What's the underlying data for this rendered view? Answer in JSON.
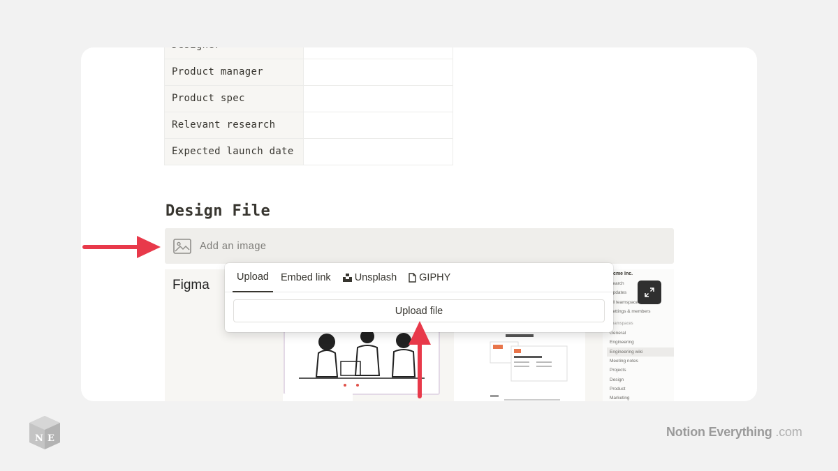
{
  "properties": [
    {
      "label": "Designer"
    },
    {
      "label": "Product manager"
    },
    {
      "label": "Product spec"
    },
    {
      "label": "Relevant research"
    },
    {
      "label": "Expected launch date"
    }
  ],
  "section_heading": "Design File",
  "add_image_label": "Add an image",
  "embed": {
    "title": "Figma",
    "sidebar": {
      "workspace": "Acme Inc.",
      "top_items": [
        "Search",
        "Updates",
        "All teamspaces",
        "Settings & members"
      ],
      "section_label": "Teamspaces",
      "items": [
        "General",
        "Engineering",
        "Engineering wiki",
        "Meeting notes",
        "Projects",
        "Design",
        "Product",
        "Marketing"
      ]
    }
  },
  "popover": {
    "tabs": [
      "Upload",
      "Embed link",
      "Unsplash",
      "GIPHY"
    ],
    "active_tab": "Upload",
    "upload_button": "Upload file"
  },
  "footer": {
    "logo_letters": "NE",
    "brand_name": "Notion Everything",
    "brand_suffix": ".com"
  },
  "colors": {
    "accent_arrow": "#e8394a",
    "page_background": "#f2f2f2"
  }
}
